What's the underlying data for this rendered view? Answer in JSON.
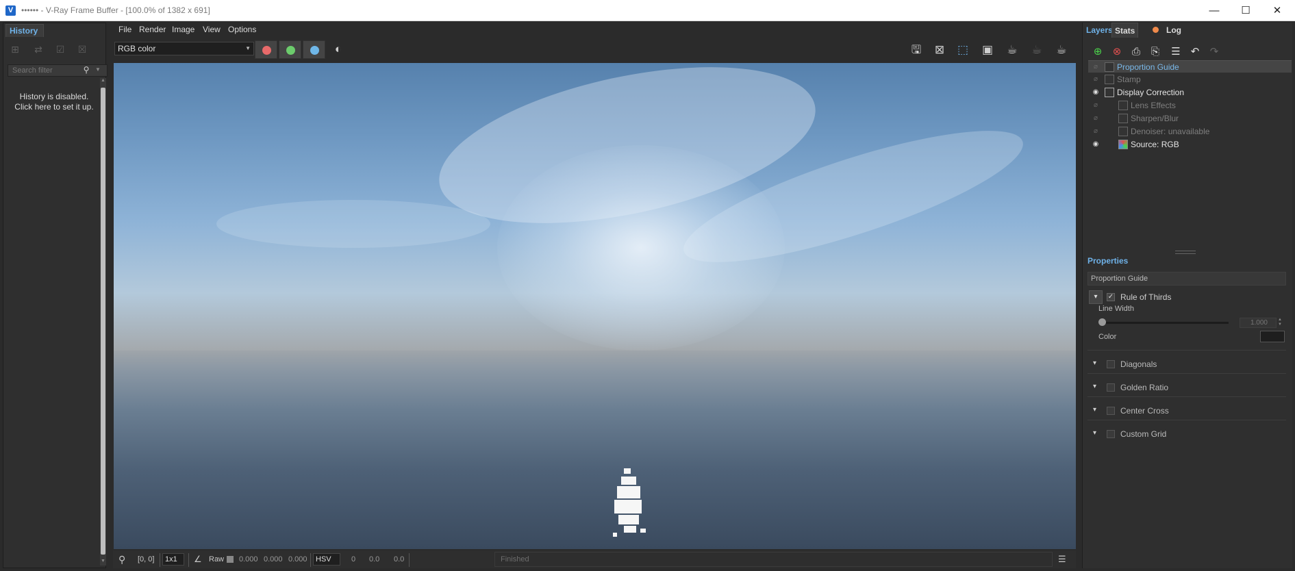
{
  "window": {
    "title": "•••••• - V-Ray Frame Buffer - [100.0% of 1382 x 691]",
    "app_icon_glyph": "V",
    "controls": [
      "—",
      "☐",
      "✕"
    ]
  },
  "history": {
    "tab": "History",
    "search_placeholder": "Search filter",
    "message_line1": "History is disabled.",
    "message_line2": "Click here to set it up."
  },
  "menu": [
    "File",
    "Render",
    "Image",
    "View",
    "Options"
  ],
  "channel": {
    "selected": "RGB color"
  },
  "channel_buttons": [
    {
      "name": "red-channel",
      "color": "#e86a6a"
    },
    {
      "name": "green-channel",
      "color": "#6ccc6c"
    },
    {
      "name": "blue-channel",
      "color": "#6fb7e8"
    }
  ],
  "statusbar": {
    "coords": "[0, 0]",
    "zoom": "1x1",
    "raw_label": "Raw",
    "raw_values": [
      "0.000",
      "0.000",
      "0.000"
    ],
    "color_mode": "HSV",
    "hsv_values": [
      "0",
      "0.0",
      "0.0"
    ],
    "status": "Finished"
  },
  "right": {
    "tabs": [
      "Layers",
      "Stats",
      "Log"
    ],
    "log_indicator_color": "#f08a4b",
    "layers": [
      {
        "label": "Proportion Guide",
        "visible": false,
        "selected": true,
        "indent": 0
      },
      {
        "label": "Stamp",
        "visible": false,
        "selected": false,
        "indent": 0
      },
      {
        "label": "Display Correction",
        "visible": true,
        "selected": false,
        "indent": 0
      },
      {
        "label": "Lens Effects",
        "visible": false,
        "selected": false,
        "indent": 1
      },
      {
        "label": "Sharpen/Blur",
        "visible": false,
        "selected": false,
        "indent": 1
      },
      {
        "label": "Denoiser: unavailable",
        "visible": false,
        "selected": false,
        "indent": 1
      },
      {
        "label": "Source: RGB",
        "visible": true,
        "selected": false,
        "indent": 1
      }
    ],
    "properties": {
      "title": "Properties",
      "name": "Proportion Guide",
      "rule_of_thirds": "Rule of Thirds",
      "line_width_label": "Line Width",
      "line_width_value": "1.000",
      "color_label": "Color",
      "sections": [
        "Diagonals",
        "Golden Ratio",
        "Center Cross",
        "Custom Grid"
      ]
    }
  }
}
